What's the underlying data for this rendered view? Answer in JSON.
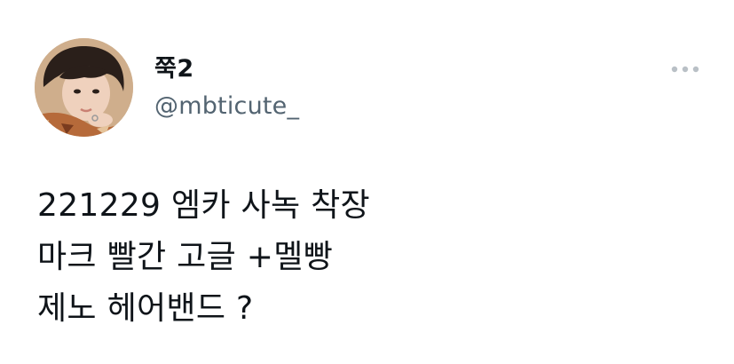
{
  "tweet": {
    "author": {
      "display_name": "쭉2",
      "handle": "@mbticute_",
      "avatar_icon": "profile-photo"
    },
    "more_icon": "more-horizontal-icon",
    "text_lines": [
      "221229 엠카 사녹 착장",
      "마크 빨간 고글 +멜빵",
      "제노 헤어밴드 ?"
    ]
  },
  "colors": {
    "text_primary": "#0f1419",
    "text_secondary": "#536471",
    "more_icon": "#b9c0c6",
    "background": "#ffffff"
  }
}
